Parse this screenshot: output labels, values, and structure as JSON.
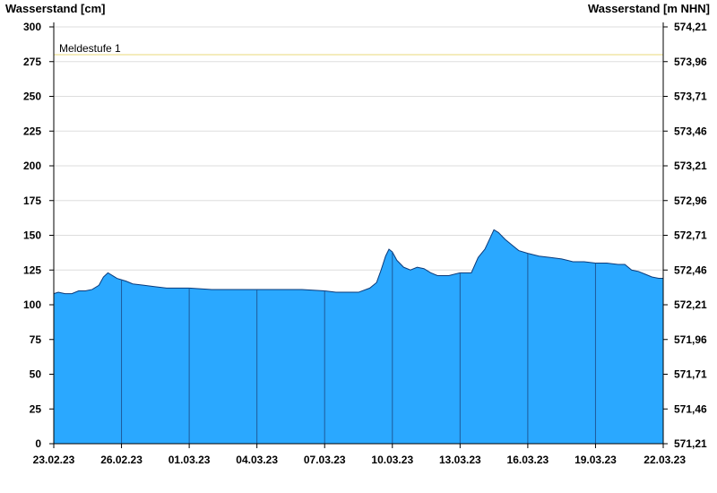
{
  "chart_data": {
    "type": "area",
    "ylabel": "Wasserstand [cm]",
    "ylabel_right": "Wasserstand [m NHN]",
    "ylim": [
      0,
      300
    ],
    "yticks": [
      0,
      25,
      50,
      75,
      100,
      125,
      150,
      175,
      200,
      225,
      250,
      275,
      300
    ],
    "yticks_right": [
      "571,21",
      "571,46",
      "571,71",
      "571,96",
      "572,21",
      "572,46",
      "572,71",
      "572,96",
      "573,21",
      "573,46",
      "573,71",
      "573,96",
      "574,21"
    ],
    "x_start": "23.02.23",
    "x_end": "22.03.23",
    "x_days": 27,
    "xticks": [
      {
        "day": 0,
        "label": "23.02.23"
      },
      {
        "day": 3,
        "label": "26.02.23"
      },
      {
        "day": 6,
        "label": "01.03.23"
      },
      {
        "day": 9,
        "label": "04.03.23"
      },
      {
        "day": 12,
        "label": "07.03.23"
      },
      {
        "day": 15,
        "label": "10.03.23"
      },
      {
        "day": 18,
        "label": "13.03.23"
      },
      {
        "day": 21,
        "label": "16.03.23"
      },
      {
        "day": 24,
        "label": "19.03.23"
      },
      {
        "day": 27,
        "label": "22.03.23"
      }
    ],
    "grid": true,
    "series": [
      {
        "x": [
          0,
          0.2,
          0.5,
          0.8,
          1.1,
          1.4,
          1.7,
          2.0,
          2.2,
          2.4,
          2.6,
          2.8,
          3.0,
          3.2,
          3.5,
          4.0,
          4.5,
          5.0,
          5.5,
          6.0,
          7.0,
          8.0,
          8.5,
          9.0,
          9.5,
          10.0,
          10.5,
          11.0,
          12.0,
          12.5,
          13.0,
          13.5,
          14.0,
          14.3,
          14.5,
          14.7,
          14.85,
          15.0,
          15.2,
          15.5,
          15.8,
          16.1,
          16.4,
          16.7,
          17.0,
          17.5,
          18.0,
          18.3,
          18.5,
          18.8,
          19.1,
          19.3,
          19.5,
          19.7,
          20.0,
          20.3,
          20.6,
          21.0,
          21.5,
          22.0,
          22.5,
          23.0,
          23.5,
          24.0,
          24.5,
          25.0,
          25.3,
          25.6,
          25.9,
          26.2,
          26.5,
          26.8,
          27.0
        ],
        "values": [
          108,
          109,
          108,
          108,
          110,
          110,
          111,
          114,
          120,
          123,
          121,
          119,
          118,
          117,
          115,
          114,
          113,
          112,
          112,
          112,
          111,
          111,
          111,
          111,
          111,
          111,
          111,
          111,
          110,
          109,
          109,
          109,
          112,
          116,
          125,
          135,
          140,
          138,
          132,
          127,
          125,
          127,
          126,
          123,
          121,
          121,
          123,
          123,
          123,
          134,
          140,
          147,
          154,
          152,
          147,
          143,
          139,
          137,
          135,
          134,
          133,
          131,
          131,
          130,
          130,
          129,
          129,
          125,
          124,
          122,
          120,
          119,
          119
        ],
        "color": "#2aa8ff"
      }
    ],
    "annotations": [
      {
        "label": "Meldestufe 1",
        "y": 280,
        "color": "#e8d878"
      }
    ]
  }
}
